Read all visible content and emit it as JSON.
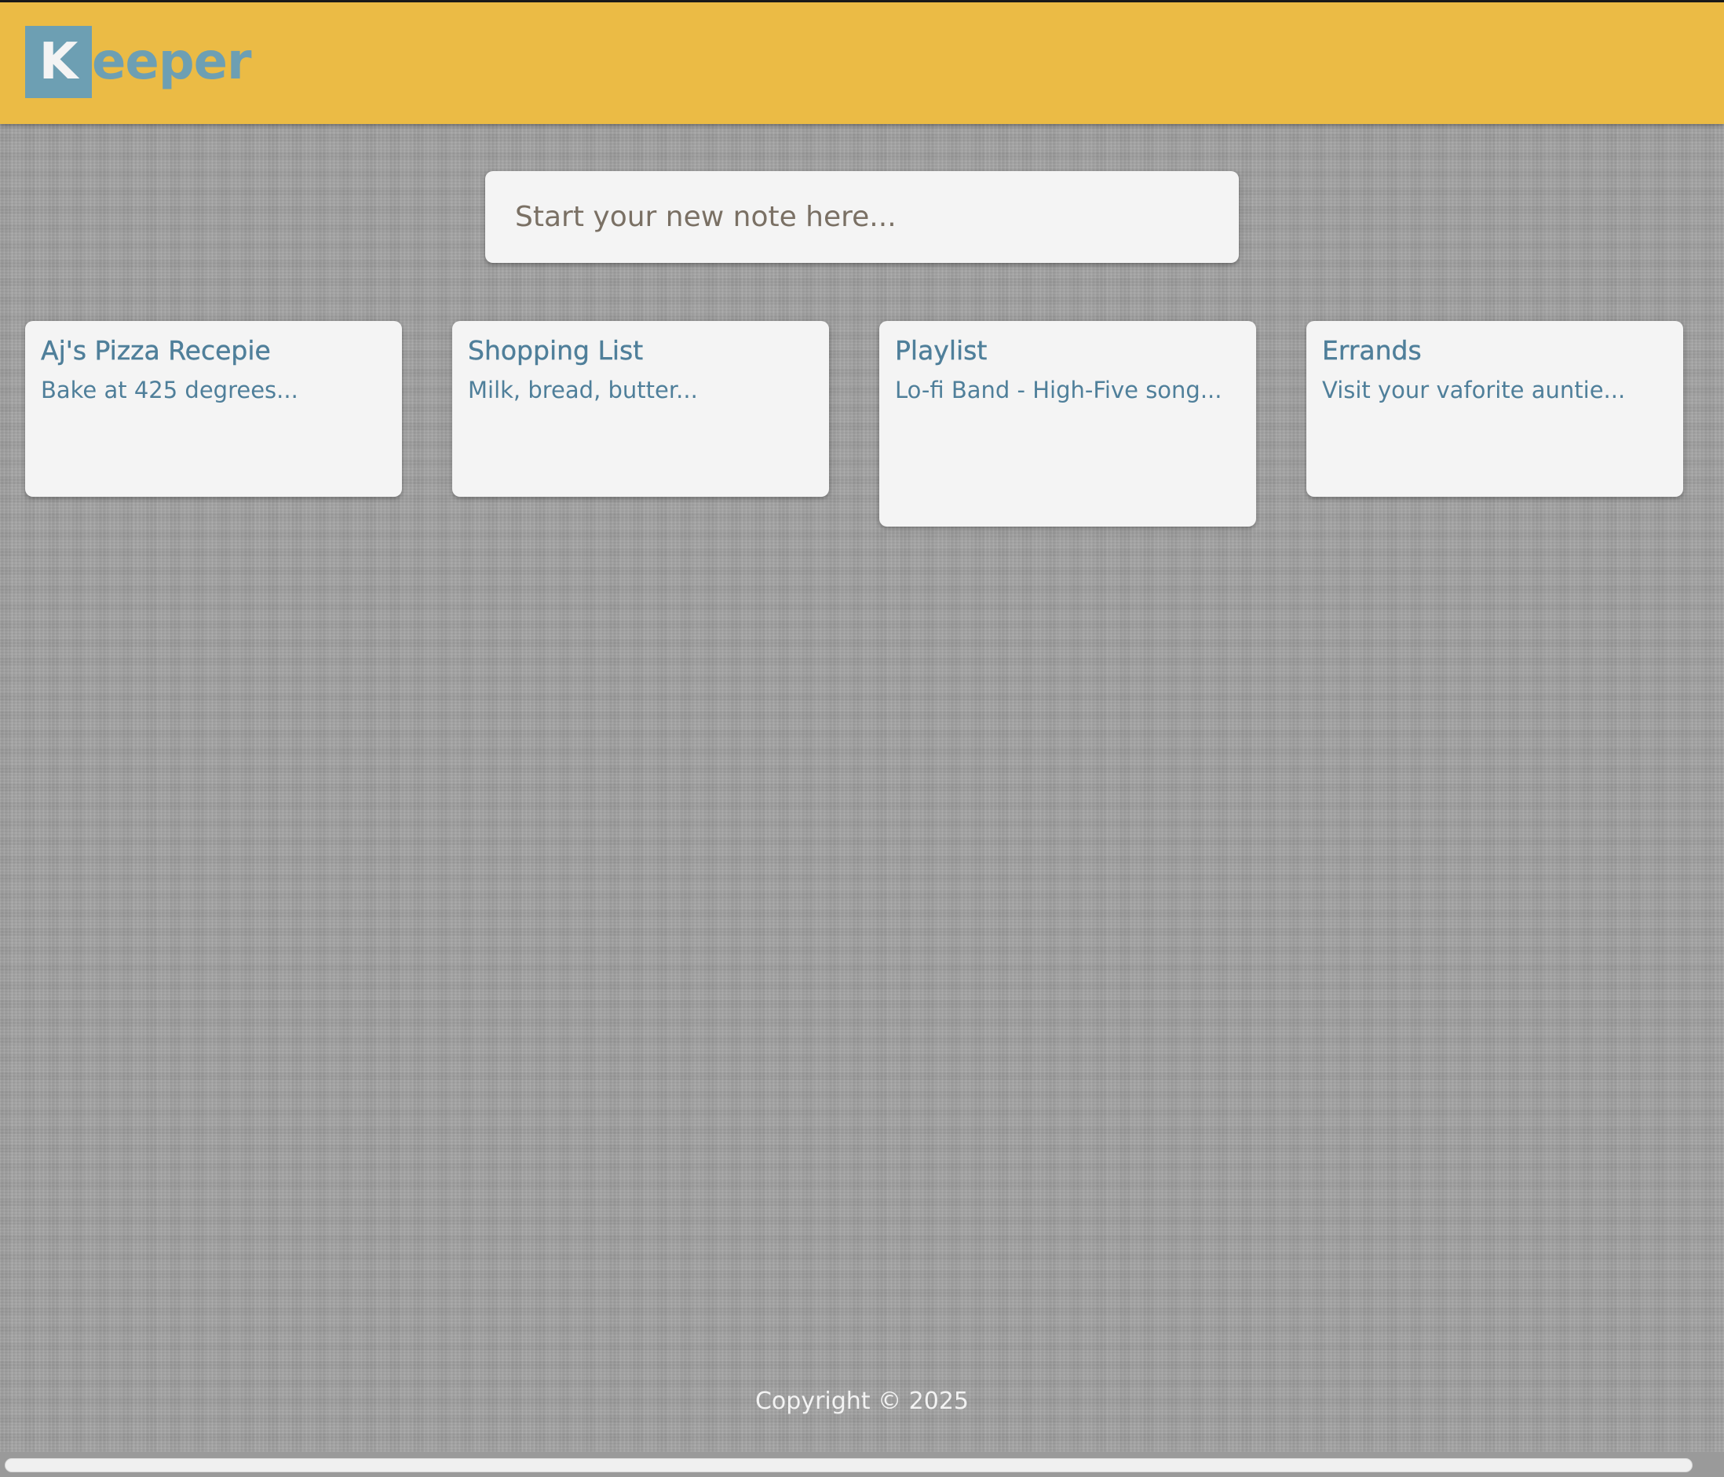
{
  "header": {
    "logo_initial": "K",
    "logo_rest": "eeper"
  },
  "create_note": {
    "placeholder": "Start your new note here..."
  },
  "notes": [
    {
      "title": "Aj's Pizza Recepie",
      "content": "Bake at 425 degrees..."
    },
    {
      "title": "Shopping List",
      "content": "Milk, bread, butter..."
    },
    {
      "title": "Playlist",
      "content": "Lo-fi Band - High-Five song..."
    },
    {
      "title": "Errands",
      "content": "Visit your vaforite auntie..."
    }
  ],
  "footer": {
    "copyright": "Copyright © 2025"
  },
  "colors": {
    "header_bg": "#ebbb45",
    "logo_blue": "#6d9fb3",
    "note_text": "#4f7f9a",
    "card_bg": "#f4f4f4"
  }
}
